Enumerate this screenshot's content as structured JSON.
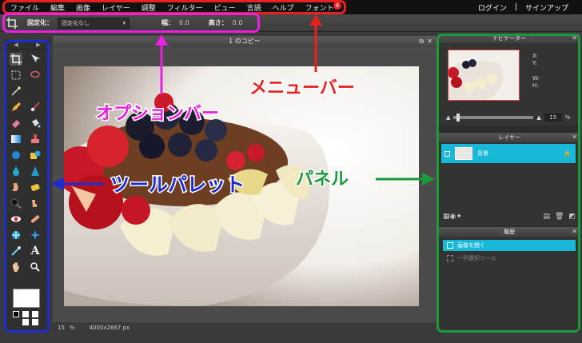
{
  "menubar": {
    "items": [
      "ファイル",
      "編集",
      "画像",
      "レイヤー",
      "調整",
      "フィルター",
      "ビュー",
      "言語",
      "ヘルプ",
      "フォント"
    ],
    "badge": "4",
    "login": "ログイン",
    "separator": "|",
    "signup": "サインアップ"
  },
  "optionsbar": {
    "constrain_label": "固定化：",
    "constrain_value": "固定化なし",
    "width_label": "幅：",
    "width_value": "0.0",
    "height_label": "高さ：",
    "height_value": "0.0"
  },
  "canvas": {
    "title": "1 のコピー",
    "zoom": "15",
    "zoom_unit": "%",
    "size": "4000x2667 px"
  },
  "navigator": {
    "title": "ナビゲーター",
    "x_label": "X:",
    "y_label": "Y:",
    "w_label": "W:",
    "h_label": "H:",
    "zoom": "15",
    "zoom_unit": "%"
  },
  "layers": {
    "title": "レイヤー",
    "layer_name": "背景"
  },
  "history": {
    "title": "履歴",
    "items": [
      "画像を開く",
      "一列選択ツール"
    ]
  },
  "annotations": {
    "menubar": "メニューバー",
    "optionsbar": "オプションバー",
    "toolpalette": "ツールパレット",
    "panel": "パネル"
  },
  "colors": {
    "menubar_box": "#e8201f",
    "options_box": "#ea1fe0",
    "tools_box": "#1d2ccf",
    "panel_box": "#1a9a3a",
    "accent": "#18b8d8"
  }
}
